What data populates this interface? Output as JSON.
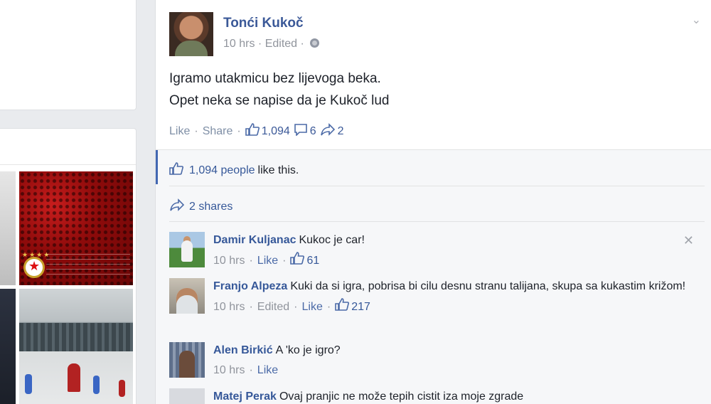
{
  "post": {
    "author": "Tonći Kukoč",
    "time": "10 hrs",
    "edited": "Edited",
    "privacy_icon": "globe-icon",
    "text_lines": [
      "Igramo utakmicu bez lijevoga beka.",
      "Opet neka se napise da je Kukoč lud"
    ],
    "actions": {
      "like": "Like",
      "share": "Share",
      "likes_count": "1,094",
      "comments_count": "6",
      "shares_count": "2"
    }
  },
  "ufi": {
    "likes_link": "1,094 people",
    "likes_suffix": "like this.",
    "shares_text": "2 shares"
  },
  "comments": [
    {
      "name": "Damir Kuljanac",
      "text": "Kukoc je car!",
      "time": "10 hrs",
      "like": "Like",
      "likes": "61",
      "edited": ""
    },
    {
      "name": "Franjo Alpeza",
      "text": "Kuki da si igra, pobrisa bi cilu desnu stranu talijana, skupa sa kukastim križom!",
      "time": "10 hrs",
      "edited": "Edited",
      "like": "Like",
      "likes": "217"
    },
    {
      "name": "Alen Birkić",
      "text": "A 'ko je igro?",
      "time": "10 hrs",
      "like": "Like",
      "likes": "",
      "edited": ""
    },
    {
      "name": "Matej Perak",
      "text": "Ovaj pranjic ne može tepih cistit iza moje zgrade",
      "time": "",
      "like": "",
      "likes": "",
      "edited": ""
    }
  ],
  "colors": {
    "link": "#365899",
    "author": "#3b5998",
    "muted": "#90949c",
    "ufi_bg": "#f6f7f9"
  }
}
